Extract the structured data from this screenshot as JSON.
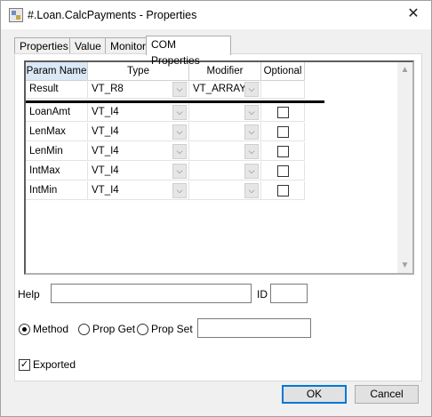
{
  "window": {
    "title": "#.Loan.CalcPayments - Properties",
    "close_glyph": "✕"
  },
  "tabs": [
    {
      "label": "Properties"
    },
    {
      "label": "Value"
    },
    {
      "label": "Monitor"
    },
    {
      "label": "COM Properties"
    }
  ],
  "grid": {
    "columns": [
      "Param Name",
      "Type",
      "Modifier",
      "Optional"
    ],
    "rows": [
      {
        "name": "Result",
        "type": "VT_R8",
        "modifier": "VT_ARRAY",
        "optional": null
      },
      {
        "name": "LoanAmt",
        "type": "VT_I4",
        "modifier": "",
        "optional": false
      },
      {
        "name": "LenMax",
        "type": "VT_I4",
        "modifier": "",
        "optional": false
      },
      {
        "name": "LenMin",
        "type": "VT_I4",
        "modifier": "",
        "optional": false
      },
      {
        "name": "IntMax",
        "type": "VT_I4",
        "modifier": "",
        "optional": false
      },
      {
        "name": "IntMin",
        "type": "VT_I4",
        "modifier": "",
        "optional": false
      }
    ]
  },
  "form": {
    "help_label": "Help",
    "help_value": "",
    "id_label": "ID",
    "id_value": "",
    "method_label": "Method",
    "propget_label": "Prop Get",
    "propset_label": "Prop Set",
    "propset_value": "",
    "selected_kind": "Method",
    "exported_label": "Exported",
    "exported_checked": true
  },
  "buttons": {
    "ok": "OK",
    "cancel": "Cancel"
  }
}
